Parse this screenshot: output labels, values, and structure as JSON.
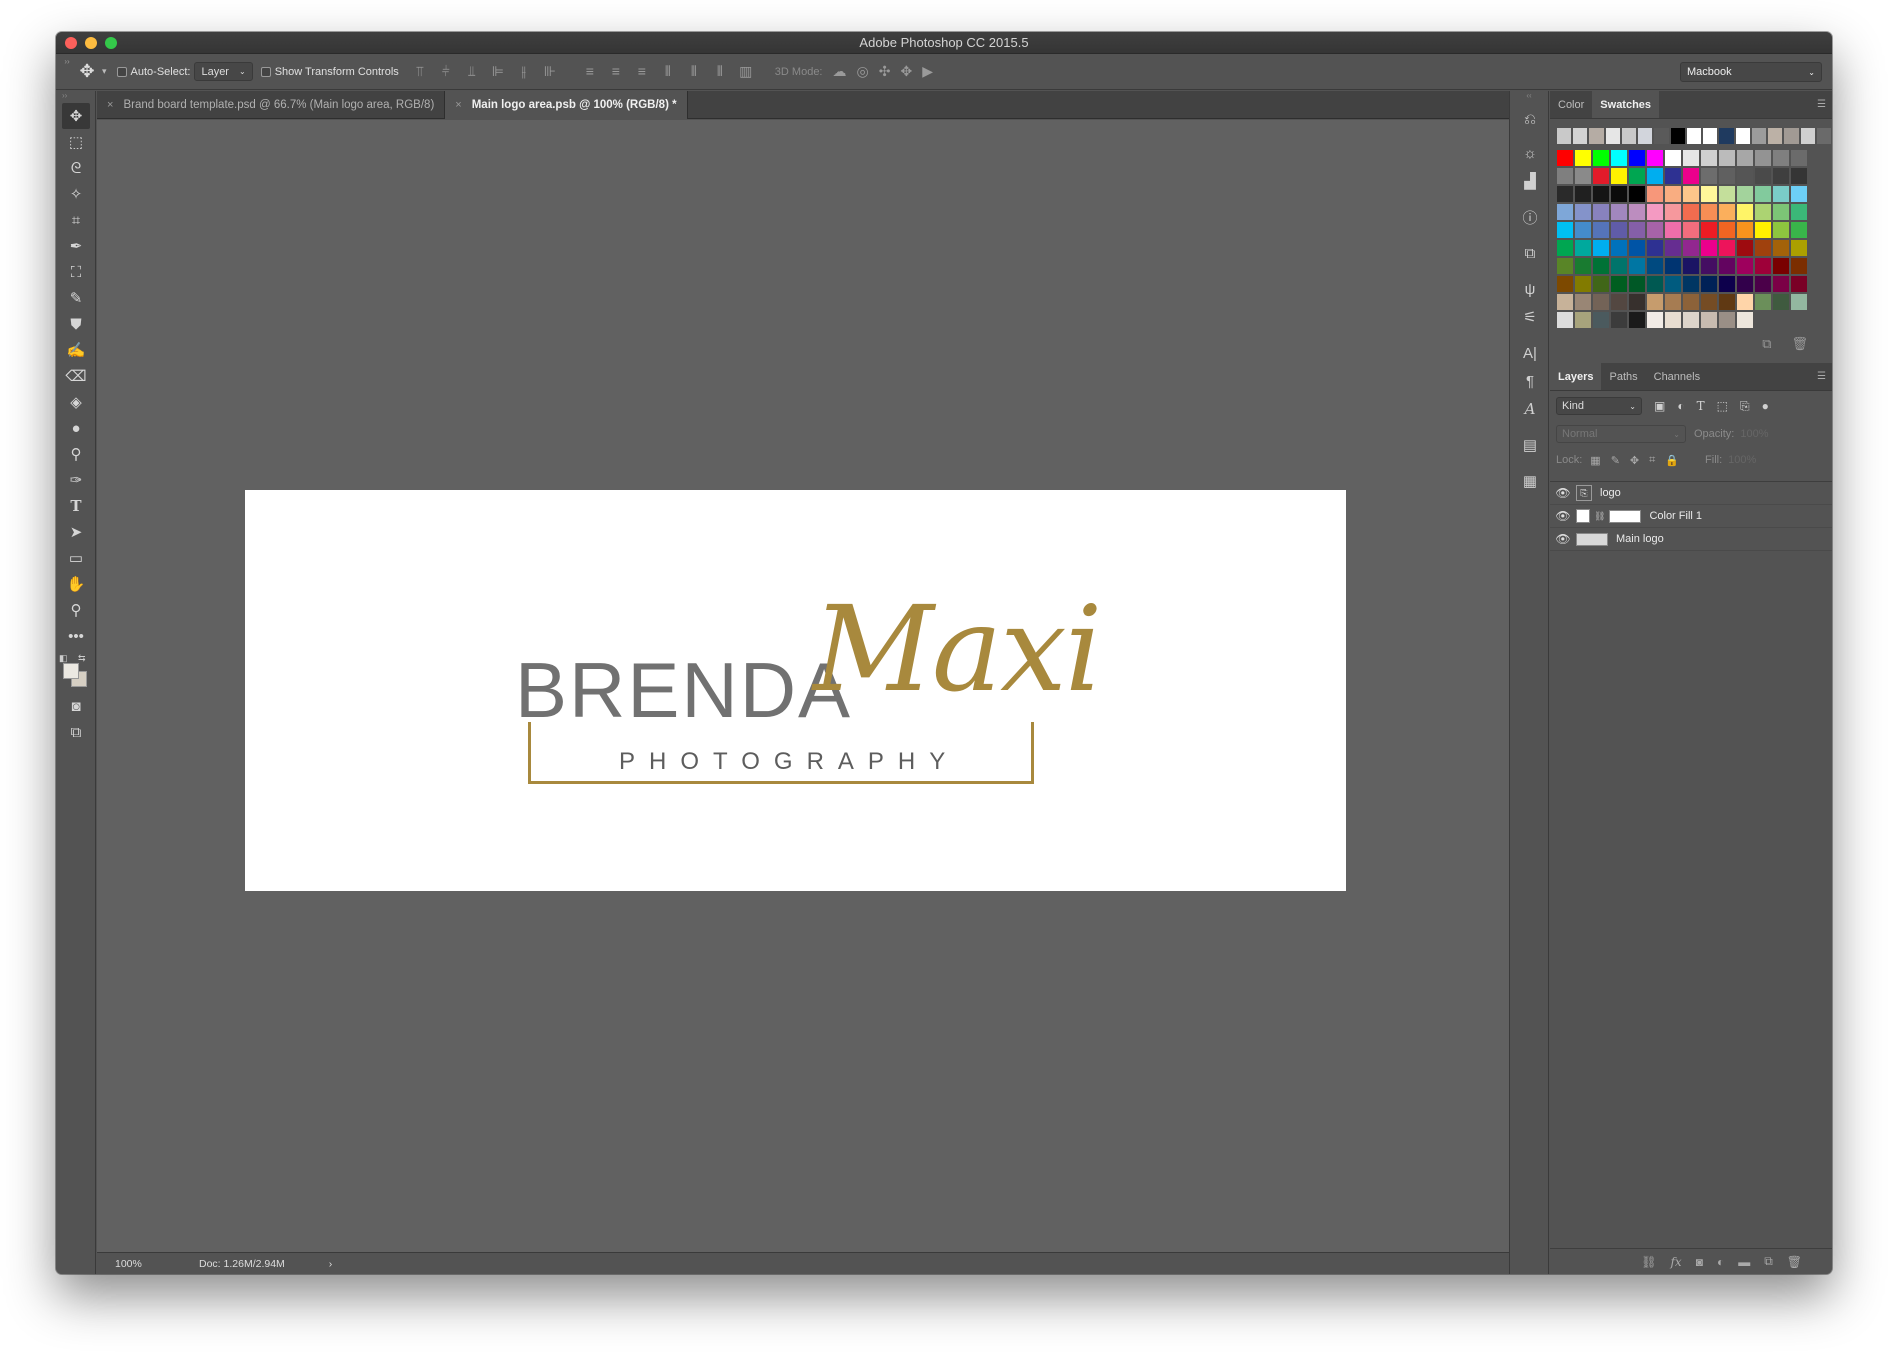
{
  "window": {
    "title": "Adobe Photoshop CC 2015.5",
    "traffic_lights": {
      "close": "#fc605b",
      "minimize": "#fdbc40",
      "zoom": "#34c84a"
    }
  },
  "options_bar": {
    "auto_select_label": "Auto-Select:",
    "auto_select_value": "Layer",
    "show_transform_label": "Show Transform Controls",
    "mode_3d_label": "3D Mode:",
    "workspace_value": "Macbook"
  },
  "document_tabs": [
    {
      "label": "Brand board template.psd @ 66.7% (Main logo area, RGB/8)",
      "active": false
    },
    {
      "label": "Main logo area.psb @ 100% (RGB/8) *",
      "active": true
    }
  ],
  "canvas": {
    "logo_name": "BRENDA",
    "logo_script": "Maxi",
    "logo_subtitle": "PHOTOGRAPHY",
    "accent_color": "#a8893d",
    "text_color": "#717171"
  },
  "status_bar": {
    "zoom": "100%",
    "doc_info": "Doc: 1.26M/2.94M"
  },
  "color_panel": {
    "tabs": [
      "Color",
      "Swatches"
    ],
    "active_tab": "Swatches",
    "swatch_rows": [
      [
        "#c9c9c9",
        "#d3d3d3",
        "#b5aca4",
        "#e6e6e6",
        "#c9c9c9",
        "#d2d5dc",
        "#5a5a5a",
        "#000000",
        "#ffffff",
        "#ffffff",
        "#1f3a5f",
        "#ffffff",
        "#9c9c9c",
        "#bcb1a6",
        "#a19a94",
        "#d0d0d0",
        "#6a6a6a"
      ],
      [
        "#ff0000",
        "#ffff00",
        "#00ff00",
        "#00ffff",
        "#0000ff",
        "#ff00ff",
        "#ffffff",
        "#e6e6e6",
        "#d0d0d0",
        "#bbbbbb",
        "#a7a7a7",
        "#939393",
        "#7f7f7f",
        "#6b6b6b"
      ],
      [
        "#7f7f7f",
        "#8a8a8a",
        "#e21b2a",
        "#fff200",
        "#00a651",
        "#00aeef",
        "#2e3192",
        "#ec008c",
        "#6d6d6d",
        "#606060",
        "#555555",
        "#4a4a4a",
        "#3f3f3f",
        "#353535"
      ],
      [
        "#2a2a2a",
        "#202020",
        "#151515",
        "#0b0b0b",
        "#000000",
        "#f7977a",
        "#f9ad81",
        "#fdc68a",
        "#fff79a",
        "#c4df9b",
        "#a3d39c",
        "#82ca9d",
        "#7accc8",
        "#6dcff6"
      ],
      [
        "#7ea7d8",
        "#8493ca",
        "#8882be",
        "#a187be",
        "#bc8dbf",
        "#f49ac2",
        "#f6989d",
        "#f26c4f",
        "#f68e55",
        "#fbaf5c",
        "#fff467",
        "#acd372",
        "#7cc576",
        "#3bb878"
      ],
      [
        "#00bff3",
        "#448ccb",
        "#5574b9",
        "#605ca8",
        "#855fa8",
        "#a763a8",
        "#f06eaa",
        "#f26d7d",
        "#ed1c24",
        "#f26522",
        "#f7941d",
        "#fff200",
        "#8dc63f",
        "#39b54a"
      ],
      [
        "#00a651",
        "#00a99d",
        "#00aeef",
        "#0072bc",
        "#0054a6",
        "#2e3192",
        "#662d91",
        "#92278f",
        "#ec008c",
        "#ed145b",
        "#9e0b0f",
        "#a0410d",
        "#a36209",
        "#aba000"
      ],
      [
        "#598527",
        "#197b30",
        "#007236",
        "#00746b",
        "#0076a3",
        "#004a80",
        "#003471",
        "#1b1464",
        "#440e62",
        "#630460",
        "#9e005d",
        "#9e0039",
        "#790000",
        "#7b2e00"
      ],
      [
        "#7d4900",
        "#827b00",
        "#406618",
        "#005e20",
        "#005826",
        "#005952",
        "#005b7f",
        "#003663",
        "#002157",
        "#0d004c",
        "#32004b",
        "#4b0049",
        "#7b0046",
        "#7a0026"
      ],
      [
        "#c7b299",
        "#998675",
        "#736357",
        "#534741",
        "#37302d",
        "#c69c6d",
        "#a67c52",
        "#8c6239",
        "#754c24",
        "#603913",
        "#ffd5a9",
        "#6b8f5a",
        "#3f5a3f",
        "#93b7a0"
      ],
      [
        "#dcdcdc",
        "#a7a37c",
        "#4b5a5e",
        "#3c3c3c",
        "#1a1a1a",
        "#f2ece6",
        "#e8ddd0",
        "#ddd4ca",
        "#c7bbb0",
        "#9a8f86",
        "#ede6dc"
      ]
    ]
  },
  "layers_panel": {
    "tabs": [
      "Layers",
      "Paths",
      "Channels"
    ],
    "active_tab": "Layers",
    "filter_kind": "Kind",
    "blend_mode": "Normal",
    "opacity_label": "Opacity:",
    "opacity_value": "100%",
    "lock_label": "Lock:",
    "fill_label": "Fill:",
    "fill_value": "100%",
    "layers": [
      {
        "name": "logo",
        "type": "smart-text"
      },
      {
        "name": "Color Fill 1",
        "type": "fill"
      },
      {
        "name": "Main logo",
        "type": "smart-object"
      }
    ]
  }
}
